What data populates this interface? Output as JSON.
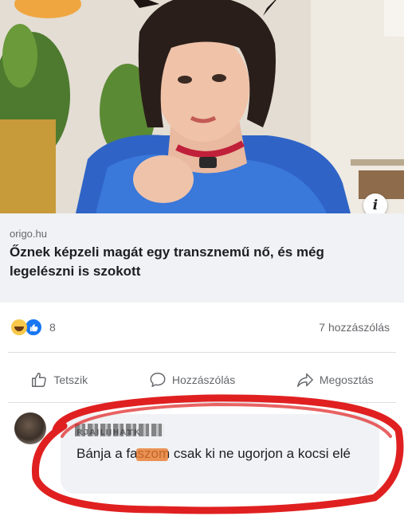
{
  "post": {
    "link": {
      "domain": "origo.hu",
      "headline": "Őznek képzeli magát egy transznemű nő, és még legelészni is szokott",
      "info_icon": "i"
    },
    "reactions": {
      "types": [
        "haha",
        "like"
      ],
      "count": "8",
      "comments_label": "7 hozzászólás"
    },
    "actions": {
      "like": "Tetszik",
      "comment": "Hozzászólás",
      "share": "Megosztás"
    }
  },
  "comment": {
    "author_obscured": "ʀᴊᴀıʟııʜᴀɤᴋ",
    "text": "Bánja a faszom csak ki ne ugorjon a kocsi elé"
  },
  "colors": {
    "accent_like": "#1877f2",
    "annotation_ring": "#e02020",
    "meta_text": "#65676b"
  }
}
